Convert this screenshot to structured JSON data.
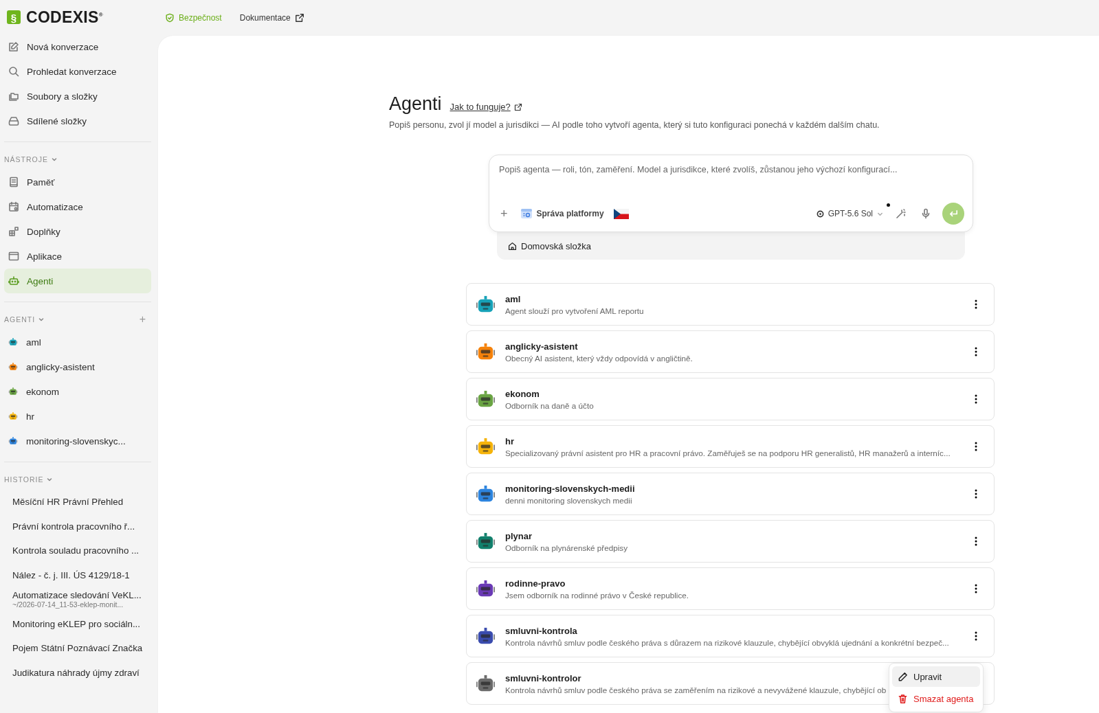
{
  "logo": {
    "mark": "§",
    "text": "CODEXIS$^{®}$"
  },
  "top_links": [
    {
      "label": "Bezpečnost",
      "kind": "security"
    },
    {
      "label": "Dokumentace",
      "kind": "external"
    }
  ],
  "sidebar": {
    "main_items": [
      {
        "label": "Nová konverzace",
        "kind": "edit",
        "selected": false
      },
      {
        "label": "Prohledat konverzace",
        "kind": "search",
        "selected": false
      },
      {
        "label": "Soubory a složky",
        "kind": "folders",
        "selected": false
      },
      {
        "label": "Sdílené složky",
        "kind": "drive",
        "selected": false
      }
    ],
    "tools": {
      "title": "NÁSTROJE",
      "expanded": true,
      "items": [
        {
          "label": "Paměť",
          "kind": "memory",
          "selected": false
        },
        {
          "label": "Automatizace",
          "kind": "calendar",
          "selected": false
        },
        {
          "label": "Doplňky",
          "kind": "addons",
          "selected": false
        },
        {
          "label": "Aplikace",
          "kind": "app",
          "selected": false
        },
        {
          "label": "Agenti",
          "kind": "robot",
          "selected": true
        }
      ]
    },
    "agents": {
      "title": "AGENTI",
      "expanded": true,
      "add": "+",
      "items": [
        {
          "label": "aml",
          "color": "#17a2b8"
        },
        {
          "label": "anglicky-asistent",
          "color": "#f5820b"
        },
        {
          "label": "ekonom",
          "color": "#6aa443"
        },
        {
          "label": "hr",
          "color": "#f5b30a"
        },
        {
          "label": "monitoring-slovenskyc...",
          "color": "#2d84de"
        }
      ]
    },
    "history": {
      "title": "HISTORIE",
      "expanded": true,
      "items": [
        {
          "title": "Měsíční HR Právní Přehled"
        },
        {
          "title": "Právní kontrola pracovního ř..."
        },
        {
          "title": "Kontrola souladu pracovního ..."
        },
        {
          "title": "Nález - č. j. III. ÚS 4129/18-1"
        },
        {
          "title": "Automatizace sledování VeKL...",
          "subtitle": "~/2026-07-14_11-53-eklep-monit..."
        },
        {
          "title": "Monitoring eKLEP pro sociáln..."
        },
        {
          "title": "Pojem Státní Poznávací Značka"
        },
        {
          "title": "Judikatura náhrady újmy zdraví"
        }
      ]
    }
  },
  "page": {
    "title": "Agenti",
    "help_link": "Jak to funguje?",
    "description": "Popiš personu, zvol jí model a jurisdikci — AI podle toho vytvoří agenta, který si tuto konfiguraci ponechá v každém dalším chatu."
  },
  "composer": {
    "placeholder": "Popiš agenta — roli, tón, zaměření. Model a jurisdikce, které zvolíš, zůstanou jeho výchozí konfigurací...",
    "add": "+",
    "source": "Správa platformy",
    "model": "GPT-5.6 Sol",
    "folder": "Domovská složka"
  },
  "agents": [
    {
      "name": "aml",
      "description": "Agent slouží pro vytvoření AML reportu",
      "color": "#17a2b8"
    },
    {
      "name": "anglicky-asistent",
      "description": "Obecný AI asistent, který vždy odpovídá v angličtině.",
      "color": "#f5820b"
    },
    {
      "name": "ekonom",
      "description": "Odborník na daně a účto",
      "color": "#6aa443"
    },
    {
      "name": "hr",
      "description": "Specializovaný právní asistent pro HR a pracovní právo. Zaměřuješ se na podporu HR generalistů, HR manažerů a interníc...",
      "color": "#f5b30a"
    },
    {
      "name": "monitoring-slovenskych-medii",
      "description": "denni monitoring slovenskych medii",
      "color": "#2d84de"
    },
    {
      "name": "plynar",
      "description": "Odborník na plynárenské předpisy",
      "color": "#12806c"
    },
    {
      "name": "rodinne-pravo",
      "description": "Jsem odborník na rodinné právo v České republice.",
      "color": "#6a3ab5"
    },
    {
      "name": "smluvni-kontrola",
      "description": "Kontrola návrhů smluv podle českého práva s důrazem na rizikové klauzule, chybějící obvyklá ujednání a konkrétní bezpeč...",
      "color": "#3a4cae"
    },
    {
      "name": "smluvni-kontrolor",
      "description": "Kontrola návrhů smluv podle českého práva se zaměřením na rizikové a nevyvážené klauzule, chybějící ob",
      "color": "#6b6b6b"
    }
  ],
  "context_menu": {
    "items": [
      {
        "label": "Upravit",
        "kind": "edit",
        "selected": true
      },
      {
        "label": "Smazat agenta",
        "kind": "delete",
        "selected": false
      }
    ]
  }
}
